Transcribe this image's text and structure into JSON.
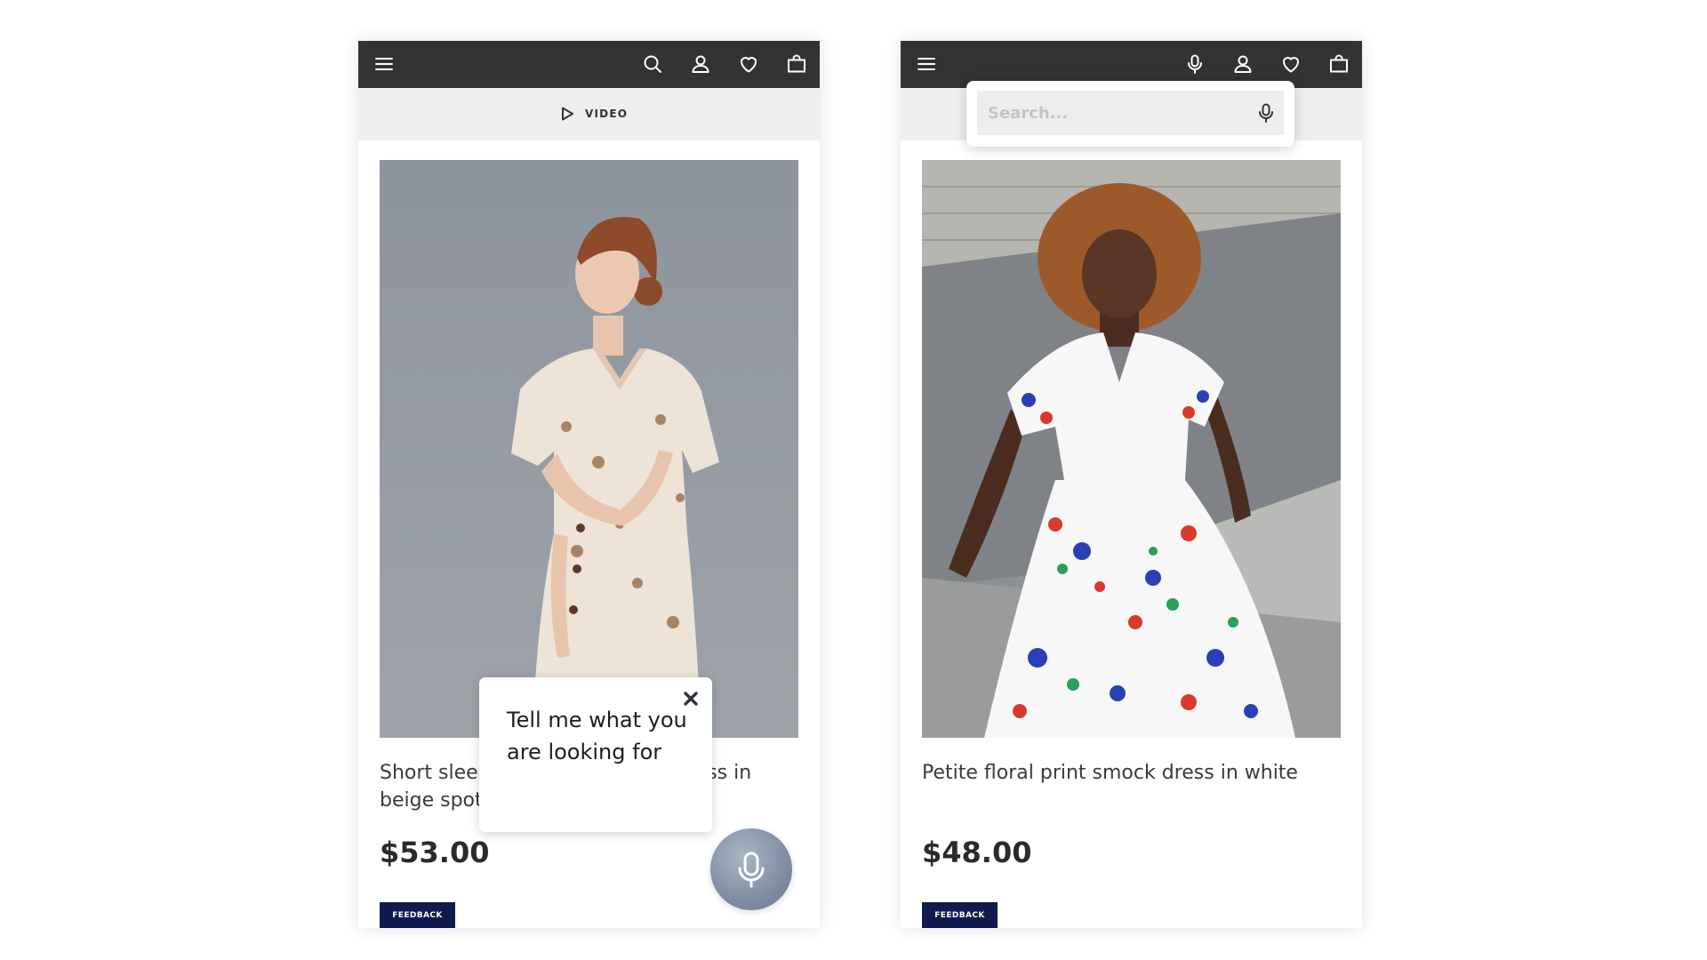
{
  "colors": {
    "topbar": "#333333",
    "subbar": "#eeeeee",
    "feedback_button": "#0f1a4d",
    "mic_button": "#7f8ea3"
  },
  "left_phone": {
    "topbar_icons": [
      "menu-icon",
      "search-icon",
      "user-icon",
      "heart-icon",
      "bag-icon"
    ],
    "video_label": "VIDEO",
    "product": {
      "image": "woman in beige floral wrap dress",
      "name": "Short sleeve wrap midi dress in beige spot",
      "name_visible_line1_start": "Short slee",
      "name_visible_line1_end": "ess in",
      "name_visible_line2": "beige spot",
      "price": "$53.00",
      "feedback_label": "FEEDBACK"
    },
    "voice_popup": {
      "text": "Tell me what you are looking for",
      "close_icon": "close-icon"
    },
    "mic_button_icon": "microphone-icon"
  },
  "right_phone": {
    "topbar_icons": [
      "menu-icon",
      "microphone-icon",
      "user-icon",
      "heart-icon",
      "bag-icon"
    ],
    "search": {
      "placeholder": "Search...",
      "value": "",
      "mic_icon": "microphone-icon"
    },
    "product": {
      "image": "woman in white floral print smock dress",
      "name": "Petite floral print smock dress in white",
      "price": "$48.00",
      "feedback_label": "FEEDBACK"
    }
  }
}
